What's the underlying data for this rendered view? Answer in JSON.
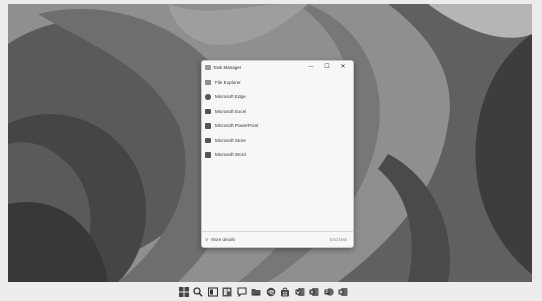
{
  "window": {
    "title": "Task Manager",
    "controls": {
      "minimize": "—",
      "maximize": "☐",
      "close": "✕"
    }
  },
  "processes": [
    {
      "label": "File Explorer",
      "icon": "folder-icon"
    },
    {
      "label": "Microsoft Edge",
      "icon": "edge-icon"
    },
    {
      "label": "Microsoft Excel",
      "icon": "excel-icon"
    },
    {
      "label": "Microsoft PowerPoint",
      "icon": "powerpoint-icon"
    },
    {
      "label": "Microsoft Store",
      "icon": "store-icon"
    },
    {
      "label": "Microsoft Word",
      "icon": "word-icon"
    }
  ],
  "footer": {
    "more_details": "More details",
    "end_task": "End task"
  },
  "taskbar": {
    "icons": [
      "start-icon",
      "search-icon",
      "task-view-icon",
      "widgets-icon",
      "chat-icon",
      "file-explorer-icon",
      "edge-icon",
      "store-icon",
      "word-icon",
      "excel-icon",
      "powerpoint-icon",
      "taskbar-app-icon"
    ]
  }
}
